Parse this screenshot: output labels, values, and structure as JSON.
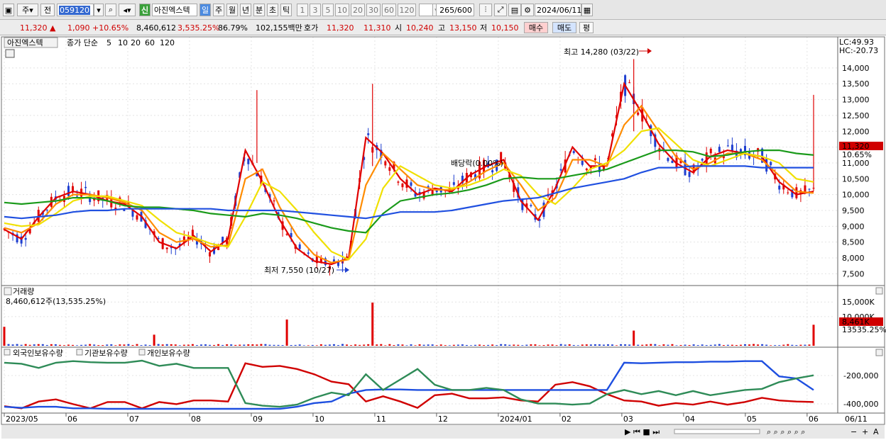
{
  "toolbar": {
    "market_label": "주",
    "prev_label": "전",
    "code": "059120",
    "name": "아진엑스텍",
    "period_labels": [
      "일",
      "주",
      "월",
      "년",
      "분",
      "초",
      "틱"
    ],
    "interval_labels": [
      "1",
      "3",
      "5",
      "10",
      "20",
      "30",
      "60",
      "120"
    ],
    "count_value": "265",
    "count_total": "/600",
    "date_value": "2024/06/11",
    "badge": "신"
  },
  "pricebar": {
    "price": "11,320",
    "change": "1,090",
    "change_pct": "+10.65%",
    "volume": "8,460,612",
    "volume_ratio": "3,535.25%",
    "ratio2": "86.79%",
    "amount": "102,155백만",
    "ask_label": "호가",
    "ask_sell": "11,320",
    "ask_buy": "11,310",
    "open_label": "시",
    "open": "10,240",
    "high_label": "고",
    "high": "13,150",
    "low_label": "저",
    "low": "10,150",
    "buy_label": "매수",
    "sell_label": "매도",
    "eval_label": "평"
  },
  "price_panel": {
    "stock_tag": "아진엑스텍",
    "ma_label": "종가 단순",
    "ma_periods": [
      "5",
      "10",
      "20",
      "60",
      "120"
    ],
    "lc": "LC:49.93",
    "hc": "HC:-20.73",
    "max_note": "최고 14,280 (03/22)",
    "min_note": "최저 7,550 (10/27)",
    "dividend_note": "배당락(0.00%)",
    "last_price": "11,320",
    "last_pct": "10.65%"
  },
  "volume_panel": {
    "title": "거래량",
    "summary": "8,460,612주(13,535.25%)",
    "last_value": "8,461K",
    "last_pct": "13535.25%"
  },
  "flow_panel": {
    "series_labels": [
      "외국인보유수량",
      "기관보유수량",
      "개인보유수량"
    ]
  },
  "bottom": {
    "last_date": "06/11"
  },
  "colors": {
    "ma5": "#e00000",
    "ma10": "#ff8c00",
    "ma20": "#f0e000",
    "ma60": "#1a9a1a",
    "ma120": "#2050e0",
    "up": "#e00000",
    "down": "#1f3fd0",
    "foreign": "#d00000",
    "inst": "#1e4fe0",
    "indiv": "#2e8b57"
  },
  "chart_data": [
    {
      "type": "candlestick",
      "title": "아진엑스텍",
      "x_labels": [
        "2023/05",
        "06",
        "07",
        "08",
        "09",
        "10",
        "11",
        "12",
        "2024/01",
        "02",
        "03",
        "04",
        "05",
        "06"
      ],
      "y_ticks": [
        7500,
        8000,
        8500,
        9000,
        9500,
        10000,
        10500,
        11000,
        11500,
        12000,
        12500,
        13000,
        13500,
        14000
      ],
      "ylim": [
        7150,
        14400
      ],
      "series": [
        {
          "name": "5",
          "values": [
            8900,
            8600,
            9300,
            9900,
            10100,
            10000,
            9800,
            9700,
            9300,
            8500,
            8300,
            8700,
            8200,
            8600,
            11400,
            10400,
            9200,
            8300,
            7900,
            7800,
            8000,
            11800,
            11300,
            10500,
            10000,
            10200,
            10100,
            10600,
            10900,
            11100,
            9800,
            9200,
            10200,
            11500,
            10900,
            10900,
            13500,
            12600,
            11600,
            11000,
            10700,
            11200,
            11400,
            11300,
            11200,
            10400,
            10000,
            10100
          ]
        },
        {
          "name": "10",
          "values": [
            8950,
            8800,
            9100,
            9700,
            10000,
            10000,
            9900,
            9750,
            9500,
            8800,
            8500,
            8600,
            8350,
            8400,
            10500,
            10800,
            9600,
            8700,
            8100,
            7850,
            7950,
            10300,
            11300,
            10800,
            10300,
            10150,
            10150,
            10400,
            10750,
            11000,
            10300,
            9500,
            9900,
            11100,
            11100,
            10900,
            12200,
            12800,
            12000,
            11200,
            10800,
            11000,
            11300,
            11300,
            11100,
            10600,
            10100,
            10050
          ]
        },
        {
          "name": "20",
          "values": [
            9100,
            9000,
            9050,
            9400,
            9800,
            9950,
            9950,
            9800,
            9650,
            9200,
            8800,
            8650,
            8450,
            8350,
            9300,
            10400,
            10100,
            9500,
            8800,
            8200,
            7950,
            8600,
            10200,
            10900,
            10600,
            10300,
            10200,
            10300,
            10500,
            10800,
            10600,
            10000,
            9700,
            10200,
            10800,
            11000,
            11400,
            12000,
            12100,
            11600,
            11100,
            10900,
            11100,
            11300,
            11200,
            11000,
            10500,
            10400
          ]
        },
        {
          "name": "60",
          "values": [
            9750,
            9700,
            9750,
            9800,
            9900,
            9900,
            9800,
            9650,
            9600,
            9600,
            9550,
            9500,
            9400,
            9350,
            9300,
            9400,
            9350,
            9250,
            9100,
            8950,
            8850,
            8800,
            9400,
            9800,
            9900,
            10000,
            10050,
            10150,
            10300,
            10500,
            10550,
            10500,
            10500,
            10600,
            10700,
            10800,
            11000,
            11200,
            11400,
            11400,
            11350,
            11200,
            11250,
            11350,
            11400,
            11400,
            11300,
            11250
          ]
        },
        {
          "name": "120",
          "values": [
            9300,
            9250,
            9300,
            9350,
            9450,
            9500,
            9500,
            9550,
            9550,
            9550,
            9550,
            9550,
            9550,
            9500,
            9500,
            9500,
            9500,
            9450,
            9400,
            9350,
            9300,
            9250,
            9350,
            9450,
            9450,
            9450,
            9500,
            9600,
            9700,
            9800,
            9850,
            9900,
            10050,
            10200,
            10300,
            10400,
            10500,
            10700,
            10850,
            10850,
            10900,
            10900,
            10900,
            10900,
            10850,
            10850,
            10850,
            10850
          ]
        }
      ],
      "high": {
        "value": 14280,
        "date": "03/22"
      },
      "low": {
        "value": 7550,
        "date": "10/27"
      },
      "last": 11320
    },
    {
      "type": "bar",
      "title": "거래량",
      "y_ticks": [
        "15,000K",
        "10,000K"
      ],
      "ylim": [
        0,
        17000000
      ],
      "spikes": [
        {
          "label": "2023/05",
          "value": 6500000
        },
        {
          "label": "07",
          "value": 3800000
        },
        {
          "label": "09",
          "value": 9000000
        },
        {
          "label": "11",
          "value": 14800000
        },
        {
          "label": "03",
          "value": 5200000
        },
        {
          "label": "06",
          "value": 7200000
        }
      ]
    },
    {
      "type": "line",
      "title": "보유수량",
      "y_ticks": [
        "-200,000",
        "-400,000"
      ],
      "series": [
        {
          "name": "외국인보유수량",
          "values": [
            0.09,
            0.05,
            0.18,
            0.22,
            0.13,
            0.05,
            0.17,
            0.17,
            0.05,
            0.17,
            0.13,
            0.2,
            0.2,
            0.18,
            0.91,
            0.84,
            0.86,
            0.8,
            0.7,
            0.56,
            0.51,
            0.18,
            0.28,
            0.18,
            0.06,
            0.3,
            0.33,
            0.24,
            0.24,
            0.26,
            0.2,
            0.18,
            0.5,
            0.55,
            0.47,
            0.32,
            0.2,
            0.18,
            0.1,
            0.15,
            0.12,
            0.18,
            0.12,
            0.17,
            0.25,
            0.2,
            0.18,
            0.17
          ]
        },
        {
          "name": "기관보유수량",
          "values": [
            0.08,
            0.06,
            0.08,
            0.08,
            0.05,
            0.05,
            0.04,
            0.04,
            0.04,
            0.04,
            0.04,
            0.04,
            0.04,
            0.04,
            0.04,
            0.04,
            0.04,
            0.08,
            0.15,
            0.18,
            0.33,
            0.4,
            0.41,
            0.41,
            0.4,
            0.4,
            0.4,
            0.4,
            0.4,
            0.4,
            0.4,
            0.4,
            0.4,
            0.4,
            0.4,
            0.4,
            0.92,
            0.91,
            0.92,
            0.93,
            0.93,
            0.94,
            0.94,
            0.95,
            0.95,
            0.66,
            0.62,
            0.4
          ]
        },
        {
          "name": "개인보유수량",
          "values": [
            0.92,
            0.9,
            0.82,
            0.92,
            0.95,
            0.93,
            0.92,
            0.92,
            0.96,
            0.86,
            0.9,
            0.82,
            0.82,
            0.82,
            0.15,
            0.1,
            0.08,
            0.12,
            0.25,
            0.35,
            0.3,
            0.7,
            0.4,
            0.6,
            0.8,
            0.5,
            0.4,
            0.4,
            0.44,
            0.4,
            0.22,
            0.14,
            0.14,
            0.12,
            0.14,
            0.32,
            0.4,
            0.32,
            0.38,
            0.3,
            0.38,
            0.3,
            0.35,
            0.4,
            0.42,
            0.55,
            0.62,
            0.68
          ]
        }
      ]
    }
  ]
}
